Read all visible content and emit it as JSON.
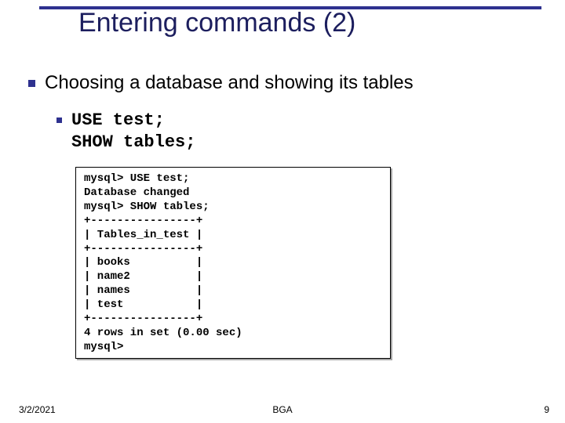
{
  "title": "Entering commands (2)",
  "bullets": {
    "lvl1": "Choosing a database and showing its tables",
    "lvl2_code": "USE test;\nSHOW tables;"
  },
  "terminal": "mysql> USE test;\nDatabase changed\nmysql> SHOW tables;\n+----------------+\n| Tables_in_test |\n+----------------+\n| books          |\n| name2          |\n| names          |\n| test           |\n+----------------+\n4 rows in set (0.00 sec)\nmysql>",
  "footer": {
    "date": "3/2/2021",
    "author": "BGA",
    "page": "9"
  }
}
